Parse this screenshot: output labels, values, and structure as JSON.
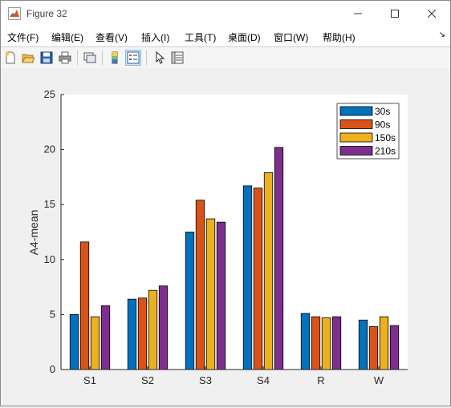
{
  "window": {
    "title": "Figure 32",
    "controls": [
      "minimize",
      "maximize",
      "close"
    ]
  },
  "menu": {
    "items": [
      "文件(F)",
      "编辑(E)",
      "查看(V)",
      "插入(I)",
      "工具(T)",
      "桌面(D)",
      "窗口(W)",
      "帮助(H)"
    ]
  },
  "toolbar": {
    "icons": [
      "new-figure-icon",
      "open-file-icon",
      "save-icon",
      "print-icon",
      "link-plot-icon",
      "insert-colorbar-icon",
      "insert-legend-icon",
      "edit-plot-cursor-icon",
      "property-inspector-icon"
    ]
  },
  "chart_data": {
    "type": "bar",
    "categories": [
      "S1",
      "S2",
      "S3",
      "S4",
      "R",
      "W"
    ],
    "series": [
      {
        "name": "30s",
        "color": "#0072BD",
        "values": [
          5.0,
          6.4,
          12.5,
          16.7,
          5.1,
          4.5
        ]
      },
      {
        "name": "90s",
        "color": "#D95319",
        "values": [
          11.6,
          6.5,
          15.4,
          16.5,
          4.8,
          3.9
        ]
      },
      {
        "name": "150s",
        "color": "#EDB120",
        "values": [
          4.8,
          7.2,
          13.7,
          17.9,
          4.7,
          4.8
        ]
      },
      {
        "name": "210s",
        "color": "#7E2F8E",
        "values": [
          5.8,
          7.6,
          13.4,
          20.2,
          4.8,
          4.0
        ]
      }
    ],
    "ylabel": "A4-mean",
    "xlabel": "",
    "ylim": [
      0,
      25
    ],
    "yticks": [
      0,
      5,
      10,
      15,
      20,
      25
    ],
    "grid": false,
    "legend_position": "top-right"
  }
}
